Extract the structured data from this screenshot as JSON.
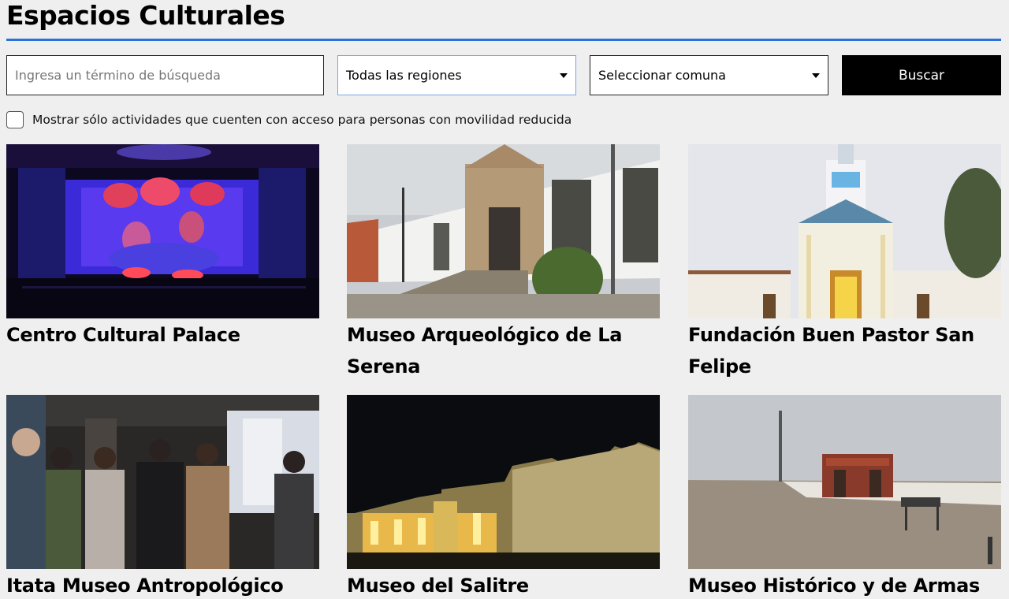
{
  "page": {
    "title": "Espacios Culturales"
  },
  "filters": {
    "search_placeholder": "Ingresa un término de búsqueda",
    "region_selected": "Todas las regiones",
    "comuna_selected": "Seleccionar comuna",
    "search_button": "Buscar",
    "accessibility_label": "Mostrar sólo actividades que cuenten con acceso para personas con movilidad reducida",
    "accessibility_checked": false
  },
  "colors": {
    "accent": "#2a72d8",
    "button_bg": "#000000",
    "page_bg": "#efefef"
  },
  "cards": [
    {
      "title": "Centro Cultural Palace",
      "image": "theater-stage-photo"
    },
    {
      "title": "Museo Arqueológico de La Serena",
      "image": "museum-facade-photo"
    },
    {
      "title": "Fundación Buen Pastor San Felipe",
      "image": "church-tower-photo"
    },
    {
      "title": "Itata Museo Antropológico",
      "image": "museum-visitors-photo"
    },
    {
      "title": "Museo del Salitre",
      "image": "night-building-photo"
    },
    {
      "title": "Museo Histórico y de Armas",
      "image": "hilltop-monument-photo"
    }
  ]
}
